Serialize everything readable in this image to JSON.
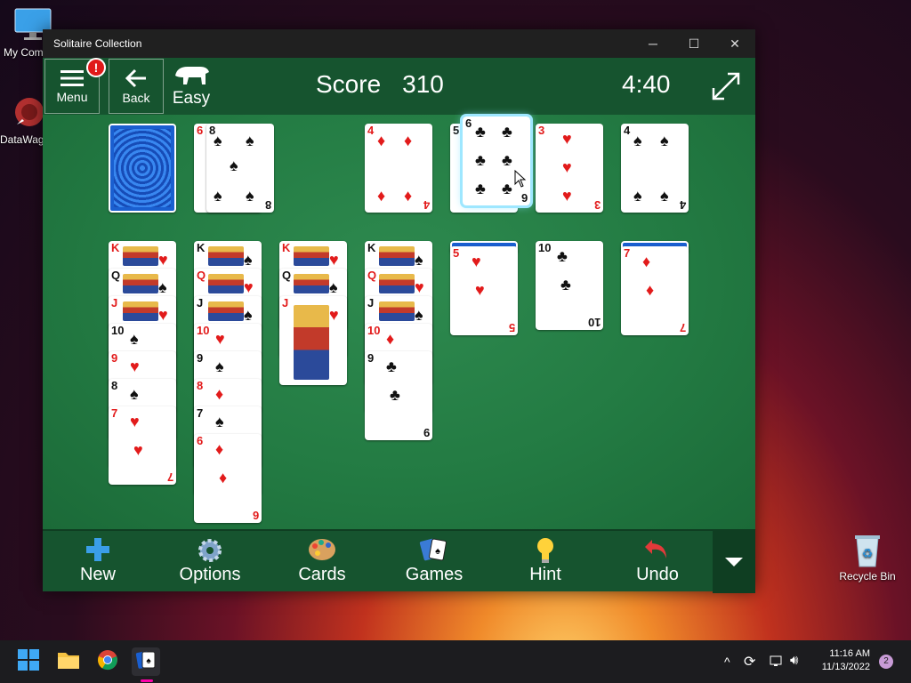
{
  "desktop": {
    "icons": [
      {
        "label": "My Com"
      },
      {
        "label": "DataWag"
      },
      {
        "label": "Recycle Bin"
      }
    ]
  },
  "window": {
    "title": "Solitaire Collection",
    "controls": {
      "minimize": "─",
      "maximize": "☐",
      "close": "✕"
    }
  },
  "topbar": {
    "menu_label": "Menu",
    "menu_badge": "!",
    "back_label": "Back",
    "difficulty": "Easy",
    "score_label": "Score",
    "score_value": "310",
    "timer": "4:40"
  },
  "cards": {
    "stock": {
      "rank": ""
    },
    "waste": {
      "rank": "8",
      "under_rank": "6"
    },
    "foundation_1": {
      "rank": "4"
    },
    "foundation_2": {
      "rank": "6",
      "under_rank": "5"
    },
    "foundation_3": {
      "rank": "3"
    },
    "foundation_4": {
      "rank": "4"
    },
    "tableau_1": [
      "K",
      "Q",
      "J",
      "10",
      "9",
      "8",
      "7"
    ],
    "tableau_2": [
      "K",
      "Q",
      "J",
      "10",
      "9",
      "8",
      "7",
      "6"
    ],
    "tableau_3": [
      "K",
      "Q",
      "J"
    ],
    "tableau_4": [
      "K",
      "Q",
      "J",
      "10",
      "9"
    ],
    "tableau_5": [
      "5"
    ],
    "tableau_6": [
      "10"
    ],
    "tableau_7": [
      "7"
    ]
  },
  "bottombar": {
    "new": "New",
    "options": "Options",
    "cards": "Cards",
    "games": "Games",
    "hint": "Hint",
    "undo": "Undo"
  },
  "taskbar": {
    "time": "11:16 AM",
    "date": "11/13/2022",
    "notifications": "2"
  },
  "colors": {
    "felt": "#237b43",
    "bar": "#16542f",
    "red_suit": "#e21b1b",
    "card_back": "#1a5fd0"
  }
}
